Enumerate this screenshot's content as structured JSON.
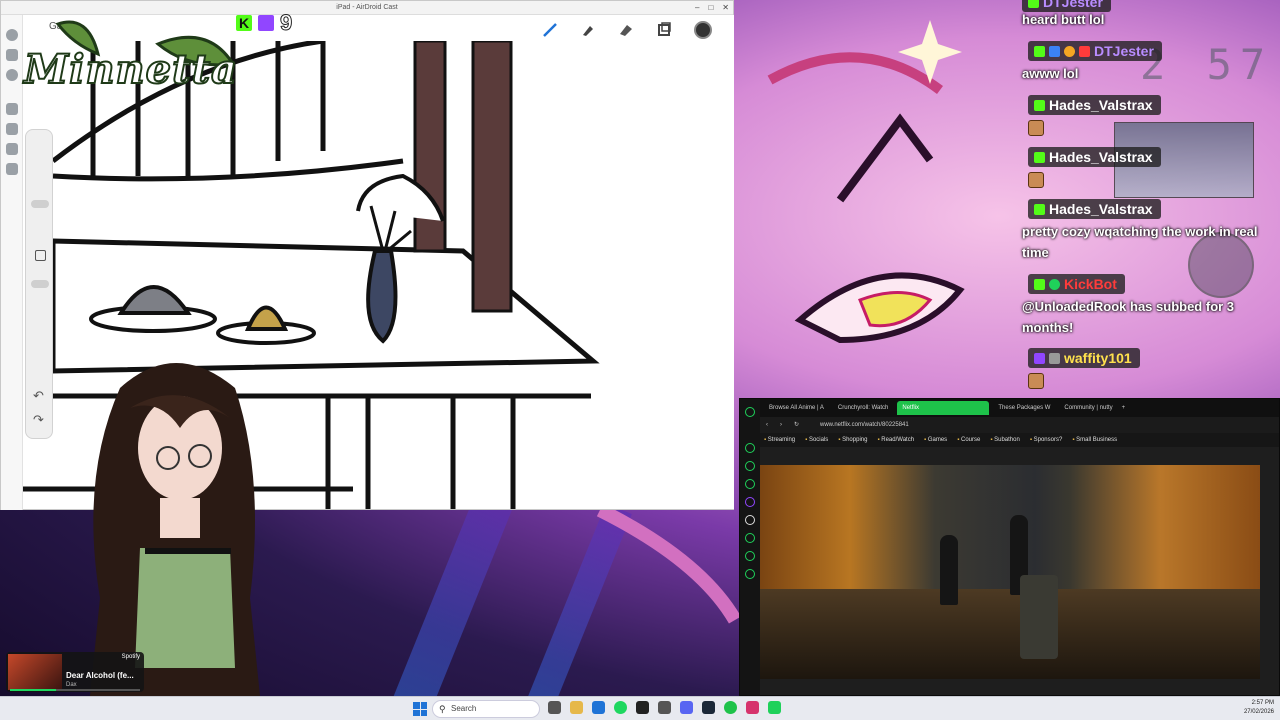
{
  "cast": {
    "window_title": "iPad - AirDroid Cast",
    "gallery_label": "Gallery",
    "logo_text": "Minnetta",
    "sub_count": "9"
  },
  "chat": {
    "timer": "2 57",
    "messages": [
      {
        "user": "DTJester",
        "user_color": "#b98cff",
        "text": "heard butt lol"
      },
      {
        "user": "DTJester",
        "user_color": "#b98cff",
        "text": "awww lol"
      },
      {
        "user": "Hades_Valstrax",
        "user_color": "#ffffff",
        "text": ""
      },
      {
        "user": "Hades_Valstrax",
        "user_color": "#ffffff",
        "text": ""
      },
      {
        "user": "Hades_Valstrax",
        "user_color": "#ffffff",
        "text": "pretty cozy wqatching the work in real time"
      },
      {
        "user": "KickBot",
        "user_color": "#ff3b3b",
        "text": "@UnloadedRook has subbed for 3 months!"
      },
      {
        "user": "waffity101",
        "user_color": "#ffe14d",
        "text": ""
      }
    ]
  },
  "browser": {
    "tabs": [
      "Browse All Anime | A",
      "Crunchyroll: Watch",
      "Netflix",
      "These Packages W",
      "Community | nutty"
    ],
    "active_tab": 2,
    "url": "www.netflix.com/watch/80225841",
    "bookmarks": [
      "Streaming",
      "Socials",
      "Shopping",
      "Read/Watch",
      "Games",
      "Course",
      "Subathon",
      "Sponsors?",
      "Small Business"
    ]
  },
  "spotify": {
    "brand": "Spotify",
    "title": "Dear Alcohol (fe...",
    "artist": "Dax",
    "progress": 0.35
  },
  "taskbar": {
    "search_placeholder": "Search",
    "time": "2:57 PM",
    "date": "27/02/2026"
  },
  "colors": {
    "kick_green": "#53fc18",
    "twitch_purple": "#9146ff",
    "netflix_tab": "#1ec24a"
  }
}
